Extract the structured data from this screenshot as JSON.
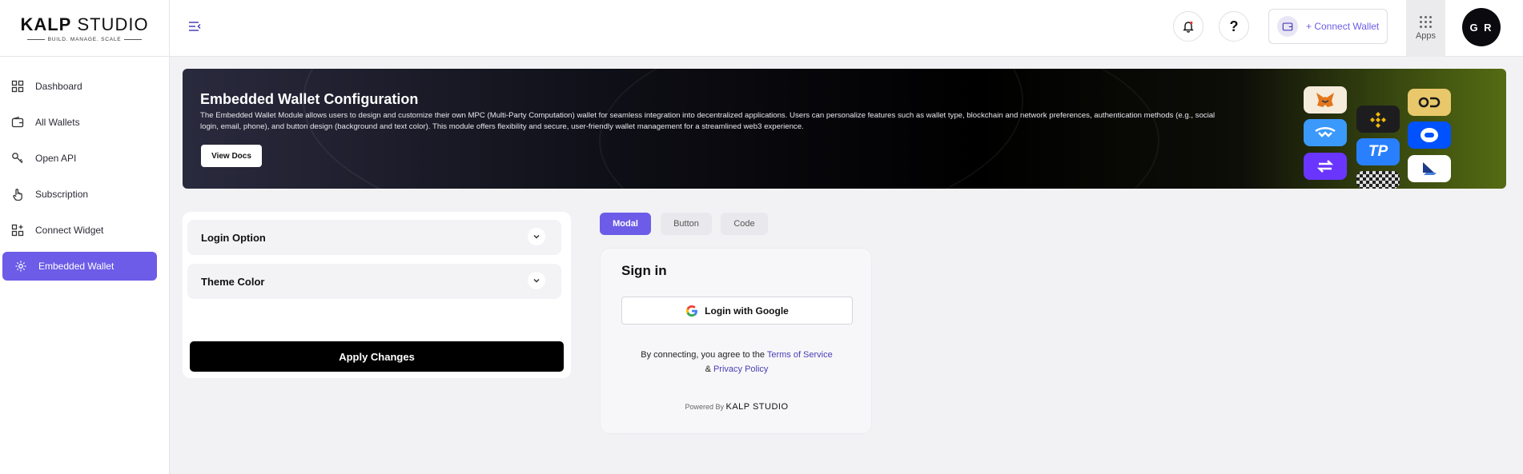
{
  "brand": {
    "logo_prefix": "K",
    "logo_mid": "ALP",
    "logo_suffix": " STUDIO",
    "tagline": "BUILD. MANAGE. SCALE"
  },
  "sidebar": {
    "items": [
      {
        "label": "Dashboard",
        "icon": "dashboard-icon"
      },
      {
        "label": "All Wallets",
        "icon": "wallet-icon"
      },
      {
        "label": "Open API",
        "icon": "key-icon"
      },
      {
        "label": "Subscription",
        "icon": "hand-tap-icon"
      },
      {
        "label": "Connect Widget",
        "icon": "widget-icon"
      },
      {
        "label": "Embedded Wallet",
        "icon": "embedded-wallet-icon",
        "active": true
      }
    ]
  },
  "topbar": {
    "help_label": "?",
    "connect_wallet_label": "+ Connect Wallet",
    "apps_label": "Apps",
    "avatar_initials": "G R"
  },
  "banner": {
    "title": "Embedded Wallet Configuration",
    "description": "The Embedded Wallet Module allows users to design and customize their own MPC (Multi-Party Computation) wallet for seamless integration into decentralized applications. Users can personalize features such as wallet type, blockchain and network preferences, authentication methods (e.g., social login, email, phone), and button design (background and text color). This module offers flexibility and secure, user-friendly wallet management for a streamlined web3 experience.",
    "button_label": "View Docs",
    "tile_tp": "TP"
  },
  "config": {
    "sections": [
      {
        "label": "Login Option"
      },
      {
        "label": "Theme Color"
      }
    ],
    "apply_label": "Apply Changes"
  },
  "tabs": [
    {
      "label": "Modal",
      "active": true
    },
    {
      "label": "Button"
    },
    {
      "label": "Code"
    }
  ],
  "signin": {
    "title": "Sign in",
    "google_label": "Login with Google",
    "terms_prefix": "By connecting, you agree to the ",
    "terms_link": "Terms of Service",
    "and_text": "& ",
    "privacy_link": "Privacy Policy",
    "powered_by": "Powered By ",
    "powered_brand": "KALP STUDIO"
  },
  "colors": {
    "accent": "#6c5ce7",
    "link": "#4a3fb5",
    "black": "#000000"
  }
}
